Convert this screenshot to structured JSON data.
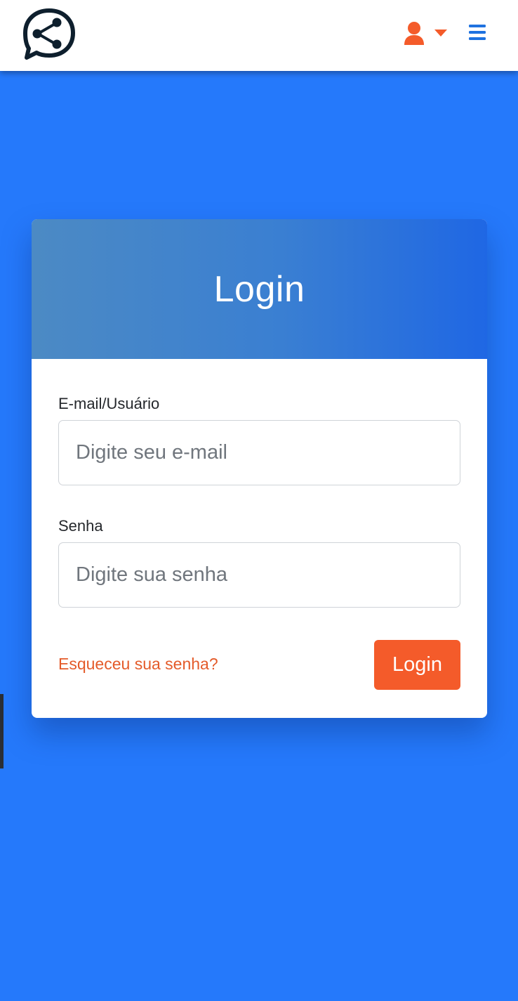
{
  "header": {
    "logo_icon": "share-chat-logo-icon",
    "user_icon": "user-icon",
    "dropdown_icon": "caret-down-icon",
    "menu_icon": "hamburger-menu-icon",
    "colors": {
      "bar_background": "#ffffff",
      "user_icon": "#f45b2a",
      "menu_icon": "#1f72e0",
      "logo": "#0e1f2d"
    }
  },
  "login_card": {
    "title": "Login",
    "email_field": {
      "label": "E-mail/Usuário",
      "placeholder": "Digite seu e-mail",
      "value": ""
    },
    "password_field": {
      "label": "Senha",
      "placeholder": "Digite sua senha",
      "value": ""
    },
    "forgot_link": "Esqueceu sua senha?",
    "submit_label": "Login"
  },
  "colors": {
    "page_background": "#2579fb",
    "header_gradient_start": "#4c8ac4",
    "header_gradient_end": "#1f67e4",
    "accent": "#f45b2a",
    "link": "#e45b2a"
  }
}
